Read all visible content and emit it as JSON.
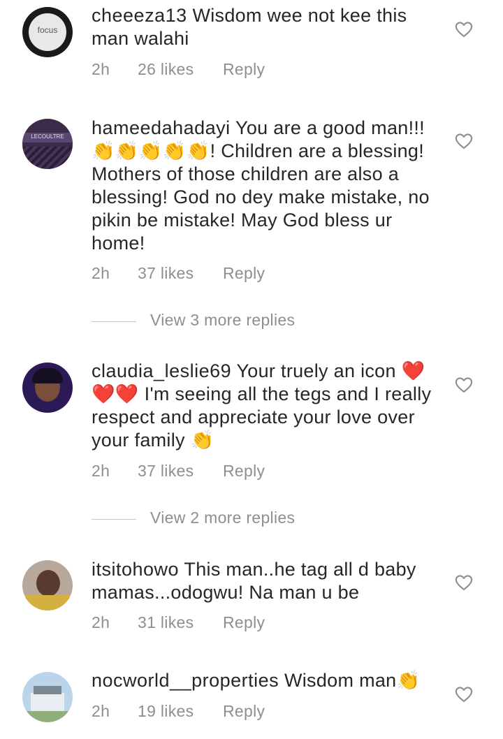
{
  "comments": [
    {
      "username": "cheeeza13",
      "text": "Wisdom wee not kee this man walahi",
      "time": "2h",
      "likes": "26 likes",
      "reply": "Reply",
      "avatar_label": "focus"
    },
    {
      "username": "hameedahadayi",
      "text": "You are a good man!!! 👏👏👏👏👏! Children are a blessing! Mothers of those children are also a blessing! God no dey make mistake, no pikin be mistake! May God bless ur home!",
      "time": "2h",
      "likes": "37 likes",
      "reply": "Reply",
      "avatar_label": "LECOULTRE"
    },
    {
      "username": "claudia_leslie69",
      "text": "Your truely an icon ❤️❤️❤️ I'm seeing all the tegs and I really respect and appreciate your love over your family 👏",
      "time": "2h",
      "likes": "37 likes",
      "reply": "Reply"
    },
    {
      "username": "itsitohowo",
      "text": "This man..he tag all d baby mamas...odogwu! Na man u be",
      "time": "2h",
      "likes": "31 likes",
      "reply": "Reply"
    },
    {
      "username": "nocworld__properties",
      "text": "Wisdom man👏",
      "time": "2h",
      "likes": "19 likes",
      "reply": "Reply"
    }
  ],
  "view_replies": [
    "View 3 more replies",
    "View 2 more replies"
  ],
  "colors": {
    "text": "#262626",
    "meta": "#8e8e8e",
    "line": "#c7c7c7"
  }
}
